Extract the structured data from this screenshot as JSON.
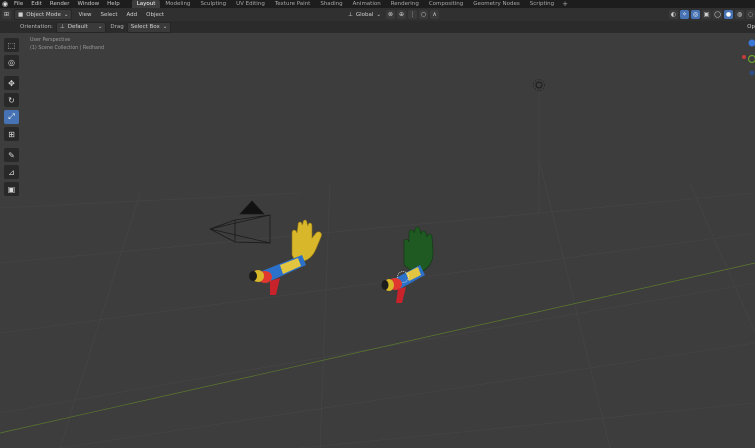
{
  "topbar": {
    "menus": [
      "File",
      "Edit",
      "Render",
      "Window",
      "Help"
    ],
    "workspaces": [
      "Layout",
      "Modeling",
      "Sculpting",
      "UV Editing",
      "Texture Paint",
      "Shading",
      "Animation",
      "Rendering",
      "Compositing",
      "Geometry Nodes",
      "Scripting"
    ],
    "active_workspace": "Layout",
    "add_label": "+"
  },
  "header": {
    "mode": "Object Mode",
    "menus": [
      "View",
      "Select",
      "Add",
      "Object"
    ],
    "transform_orientation": "Global"
  },
  "tool_settings": {
    "orientation_label": "Orientation:",
    "orientation_value": "Default",
    "drag_label": "Drag",
    "drag_value": "Select Box",
    "right_cut": "Op"
  },
  "viewport": {
    "view_label": "User Perspective",
    "collection_label": "(1) Scene Collection | Redhand"
  },
  "toolbar": {
    "tools": [
      "select-box",
      "cursor",
      "move",
      "rotate",
      "scale",
      "transform",
      "annotate",
      "measure",
      "add-cube"
    ],
    "active_tool": "scale"
  },
  "colors": {
    "background": "#3d3d3d",
    "accent": "#4772b3",
    "yellow_hand": "#d8b72a",
    "green_hand": "#1f5a22"
  }
}
